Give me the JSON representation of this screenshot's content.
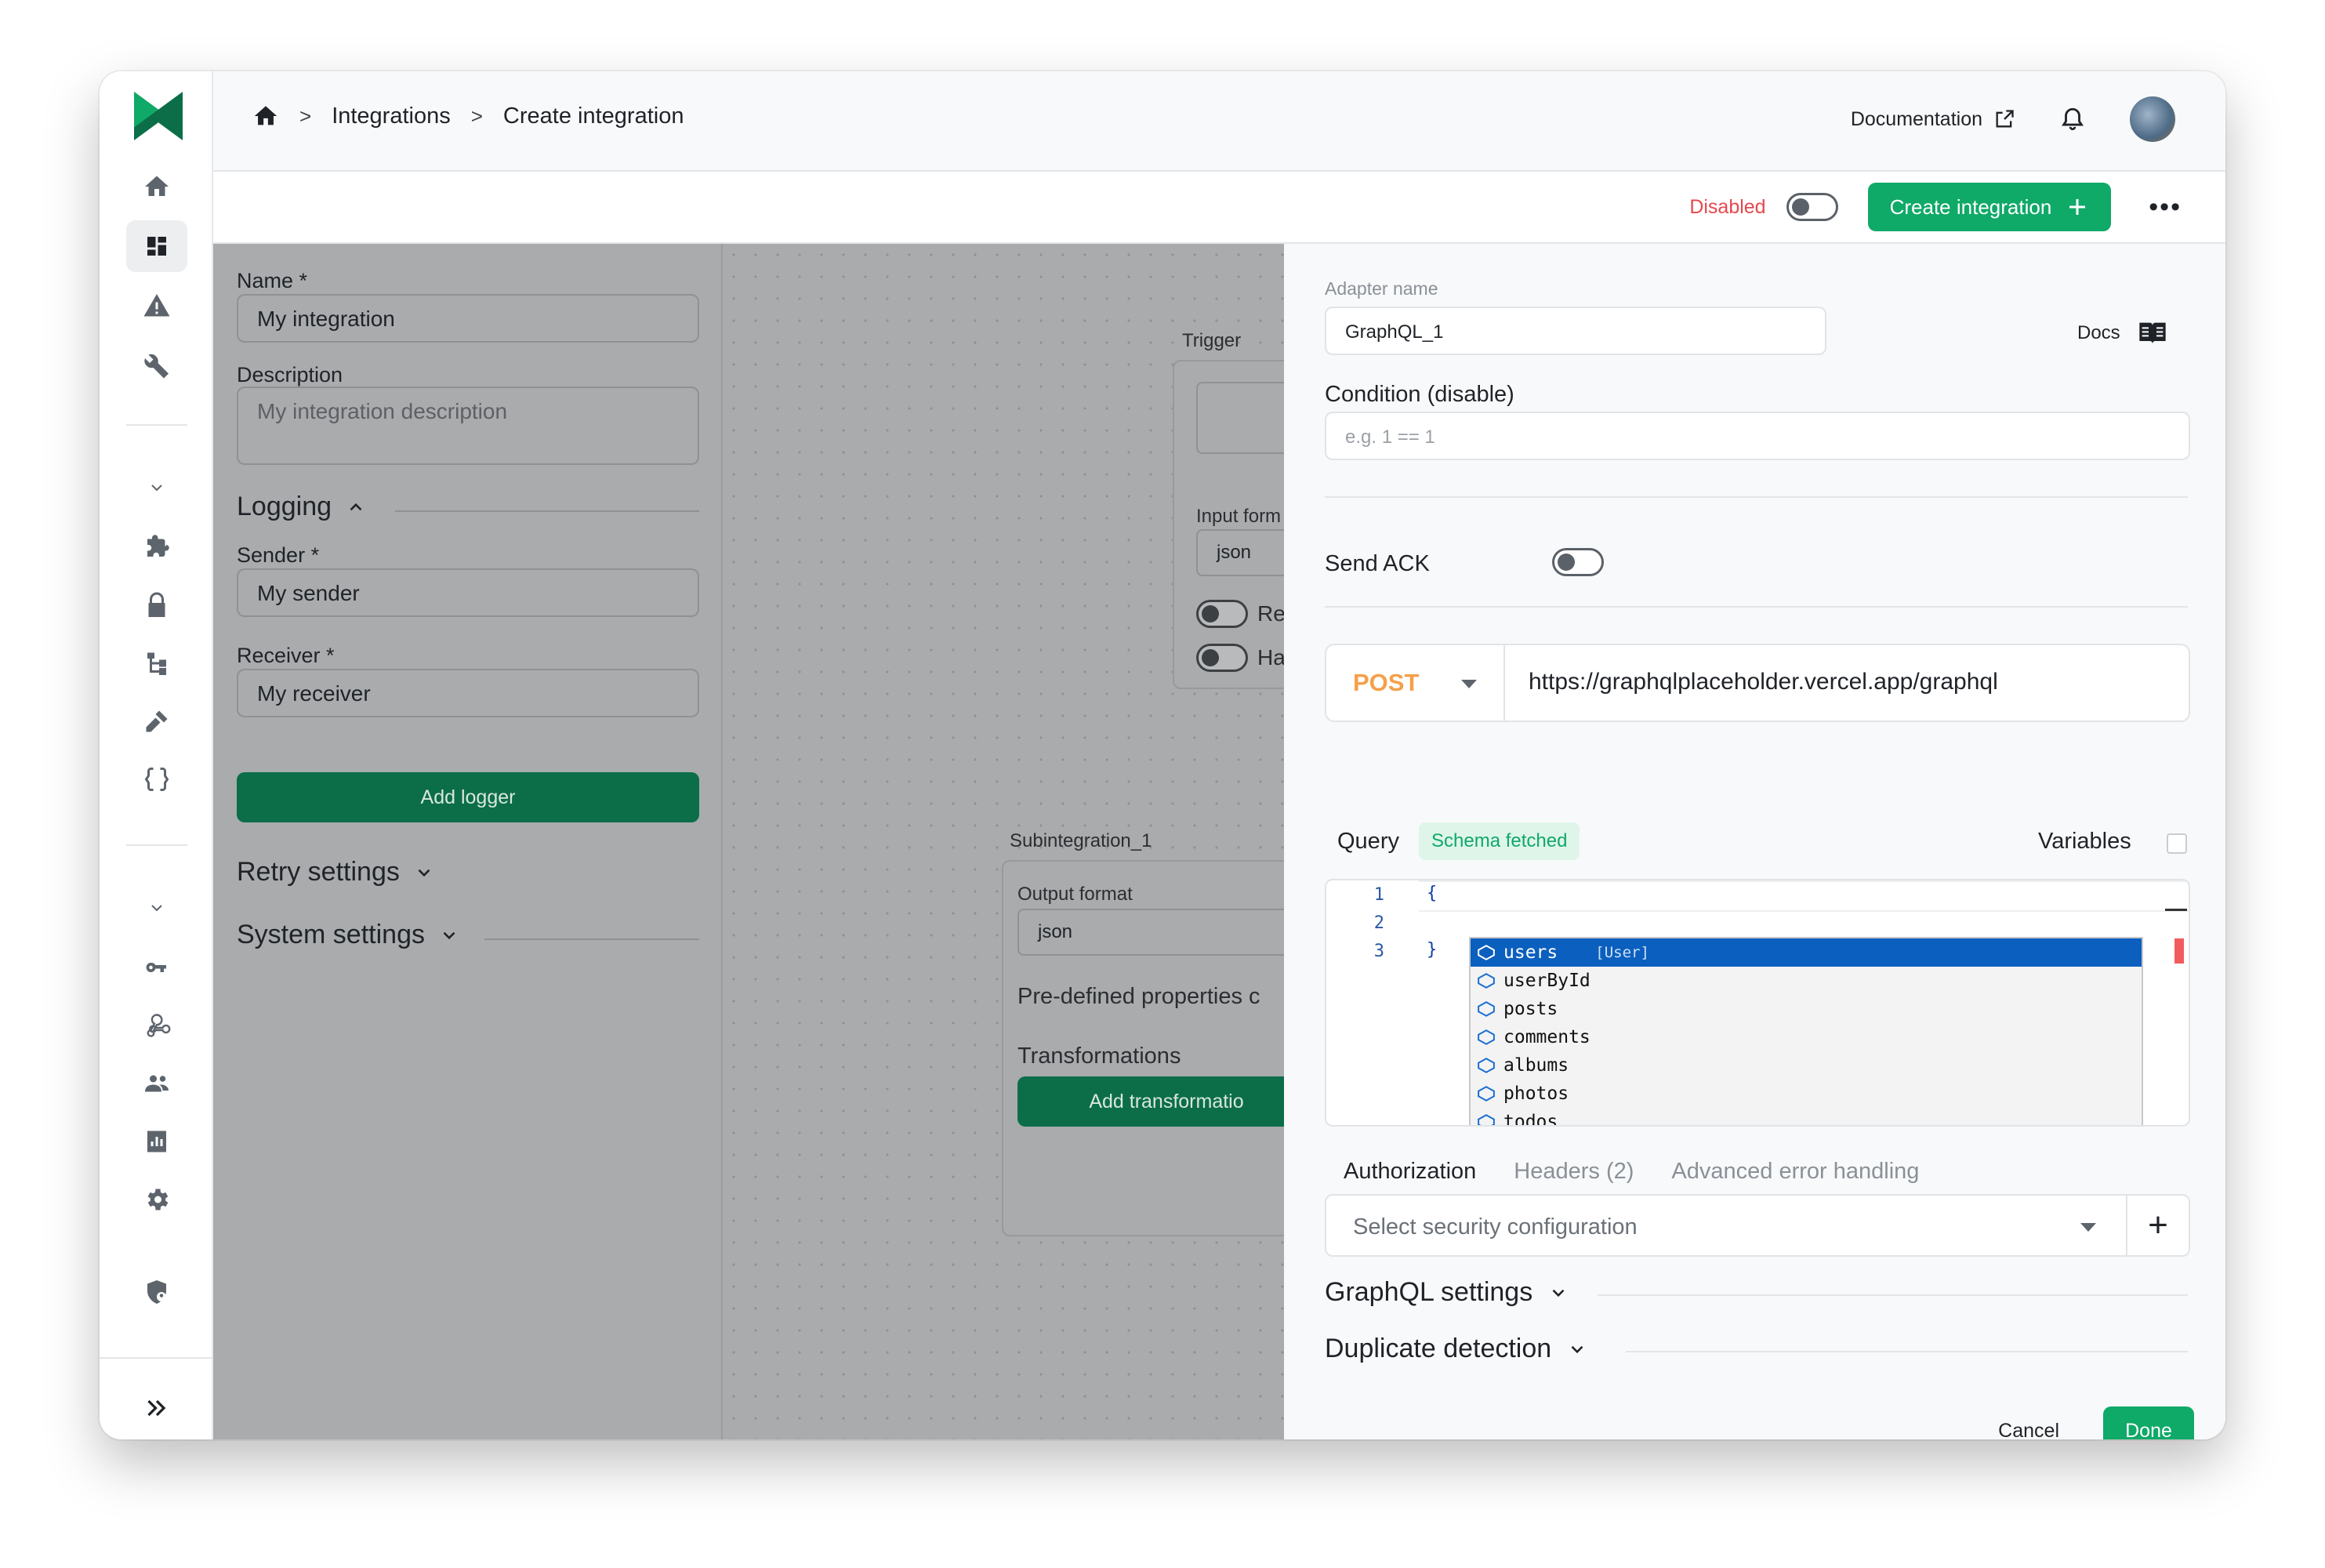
{
  "breadcrumb": {
    "home_icon": "home-icon",
    "items": [
      "Integrations",
      "Create integration"
    ],
    "separator": ">"
  },
  "header": {
    "documentation_label": "Documentation",
    "icons": [
      "external-link-icon",
      "bell-icon",
      "avatar"
    ]
  },
  "toolbar": {
    "status_label": "Disabled",
    "create_label": "Create integration",
    "more_label": "•••"
  },
  "colors": {
    "accent": "#0fa968",
    "danger": "#e5484d",
    "method": "#f5a04a",
    "dark_button": "#0b6e49"
  },
  "left_panel": {
    "name_label": "Name *",
    "name_value": "My integration",
    "description_label": "Description",
    "description_placeholder": "My integration description",
    "logging_label": "Logging",
    "sender_label": "Sender *",
    "sender_value": "My sender",
    "receiver_label": "Receiver *",
    "receiver_value": "My receiver",
    "add_logger_label": "Add logger",
    "retry_label": "Retry settings",
    "system_label": "System settings"
  },
  "canvas": {
    "trigger_label": "Trigger",
    "input_format_label": "Input form",
    "input_format_value": "json",
    "toggle1_label": "Re",
    "toggle2_label": "Ha",
    "subintegration_label": "Subintegration_1",
    "output_format_label": "Output format",
    "output_format_value": "json",
    "predefined_label": "Pre-defined properties c",
    "transformations_label": "Transformations",
    "add_transformation_label": "Add transformatio"
  },
  "right_panel": {
    "adapter_name_label": "Adapter name",
    "adapter_name_value": "GraphQL_1",
    "docs_label": "Docs",
    "condition_label": "Condition (disable)",
    "condition_placeholder": "e.g. 1 == 1",
    "send_ack_label": "Send ACK",
    "method": "POST",
    "url": "https://graphqlplaceholder.vercel.app/graphql",
    "query_label": "Query",
    "schema_badge": "Schema fetched",
    "variables_label": "Variables",
    "editor": {
      "line_numbers": [
        "1",
        "2",
        "3"
      ],
      "lines": [
        "{",
        "",
        "}"
      ],
      "suggestions": [
        "users",
        "userById",
        "posts",
        "comments",
        "albums",
        "photos",
        "todos"
      ],
      "selected_type": "[User]"
    },
    "tabs": [
      "Authorization",
      "Headers (2)",
      "Advanced error handling"
    ],
    "security_placeholder": "Select security configuration",
    "security_add": "+",
    "graphql_settings_label": "GraphQL settings",
    "duplicate_label": "Duplicate detection",
    "cancel_label": "Cancel",
    "done_label": "Done"
  }
}
